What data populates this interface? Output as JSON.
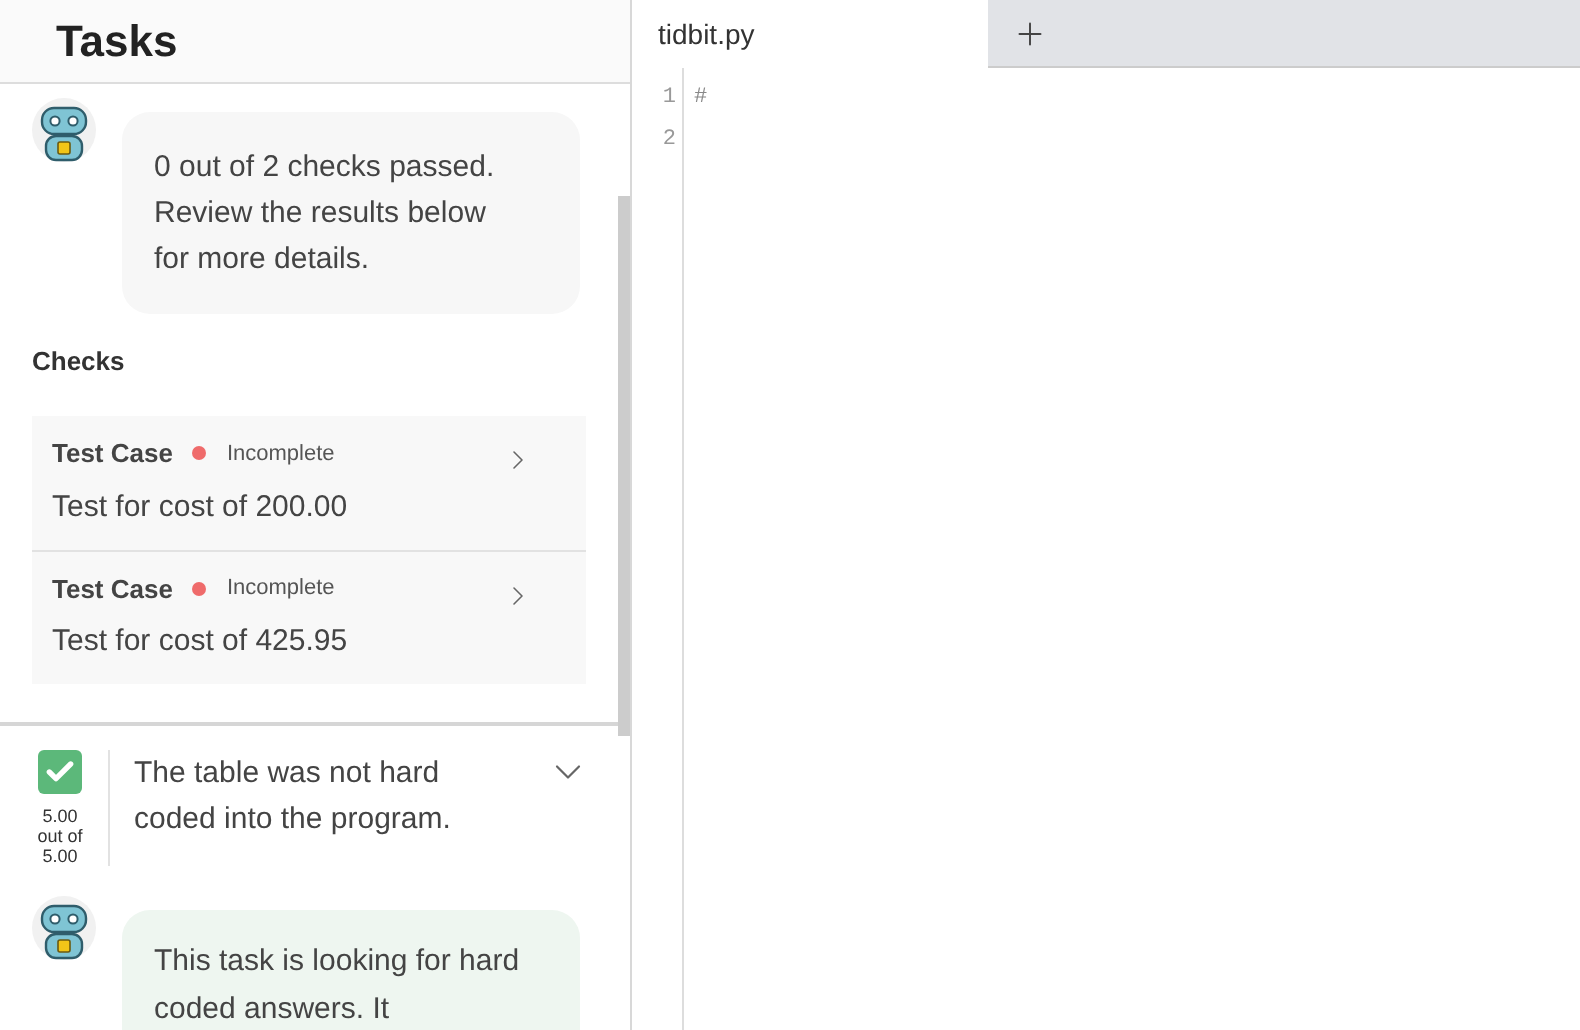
{
  "panel": {
    "title": "Tasks"
  },
  "feedback": {
    "message": "0 out of 2 checks passed. Review the results below for more details."
  },
  "checks": {
    "heading": "Checks",
    "items": [
      {
        "label": "Test Case",
        "status": "Incomplete",
        "color": "#ef6b6b",
        "description": "Test for cost of 200.00"
      },
      {
        "label": "Test Case",
        "status": "Incomplete",
        "color": "#ef6b6b",
        "description": "Test for cost of 425.95"
      }
    ]
  },
  "rubric": [
    {
      "checked": true,
      "score": "5.00 out of 5.00",
      "text": "The table was not hard coded into the program.",
      "expanded": false
    }
  ],
  "hint": {
    "message": "This task is looking for hard coded answers. It"
  },
  "editor": {
    "tabs": [
      {
        "label": "tidbit.py",
        "selected": true
      }
    ],
    "lines": [
      {
        "number": "1",
        "code": "#"
      },
      {
        "number": "2"
      }
    ]
  }
}
